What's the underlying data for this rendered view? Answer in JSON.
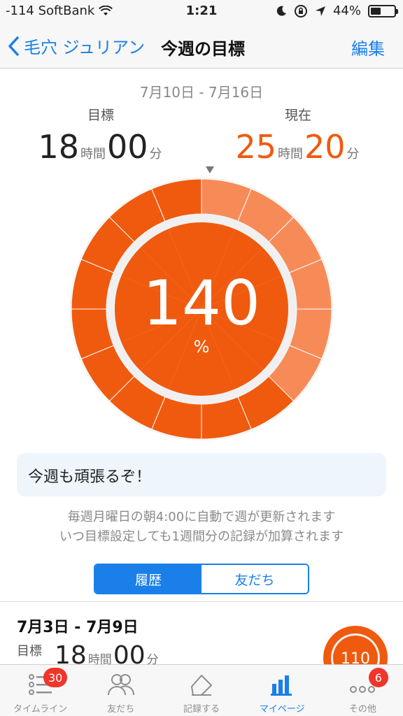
{
  "status_bar": {
    "carrier": "-114 SoftBank",
    "time": "1:21",
    "battery": "44%",
    "battery_level": 0.44
  },
  "nav": {
    "back_label": "毛穴 ジュリアン",
    "title": "今週の目標",
    "edit_label": "編集"
  },
  "week": {
    "date_range": "7月10日 - 7月16日",
    "goal_label": "目標",
    "goal_hours": "18",
    "goal_minutes": "00",
    "current_label": "現在",
    "current_hours": "25",
    "current_minutes": "20",
    "hour_unit": "時間",
    "minute_unit": "分",
    "percent": "140",
    "percent_sign": "%"
  },
  "ring": {
    "segments_total": 16,
    "inner_segments_done": 16,
    "outer_segments_done": 16,
    "outer_light_segments": 6,
    "color_main": "#f05a0e",
    "color_light": "#f78b58",
    "color_track": "#f0f0f0"
  },
  "motto": "今週も頑張るぞ！",
  "info": {
    "line1": "毎週月曜日の朝4:00に自動で週が更新されます",
    "line2": "いつ目標設定しても1週間分の記録が加算されます"
  },
  "segmented": {
    "history": "履歴",
    "friends": "友だち"
  },
  "history": [
    {
      "date_range": "7月3日 - 7月9日",
      "goal_label": "目標",
      "goal_hours": "18",
      "goal_minutes": "00",
      "percent": "110"
    }
  ],
  "tabs": [
    {
      "label": "タイムライン",
      "icon": "timeline-icon",
      "badge": "30"
    },
    {
      "label": "友だち",
      "icon": "friends-icon",
      "badge": ""
    },
    {
      "label": "記録する",
      "icon": "record-icon",
      "badge": ""
    },
    {
      "label": "マイページ",
      "icon": "mypage-icon",
      "badge": ""
    },
    {
      "label": "その他",
      "icon": "more-icon",
      "badge": "6"
    }
  ],
  "colors": {
    "accent": "#1a7fe8",
    "orange": "#f05a0e",
    "badge": "#f0352a"
  }
}
